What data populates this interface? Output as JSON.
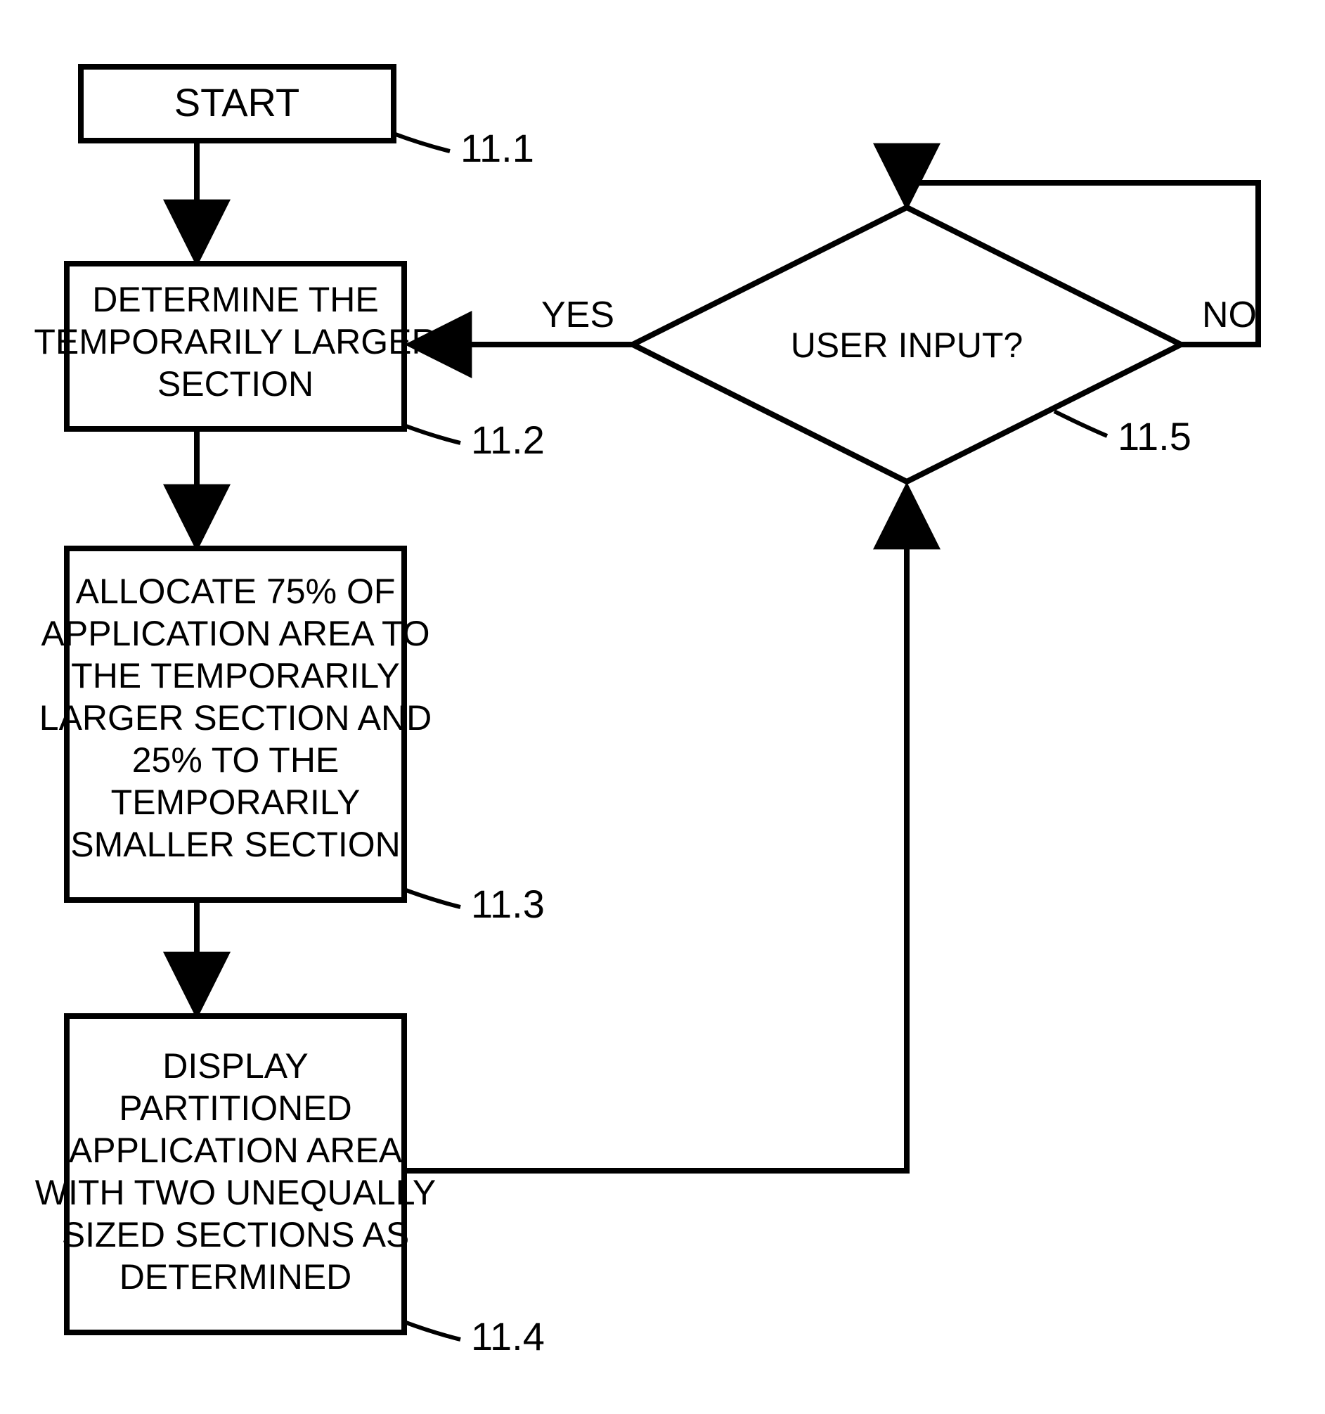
{
  "flowchart": {
    "nodes": {
      "start": {
        "text": "START",
        "ref": "11.1"
      },
      "determine": {
        "lines": [
          "DETERMINE THE",
          "TEMPORARILY LARGER",
          "SECTION"
        ],
        "ref": "11.2"
      },
      "allocate": {
        "lines": [
          "ALLOCATE 75% OF",
          "APPLICATION AREA TO",
          "THE TEMPORARILY",
          "LARGER SECTION AND",
          "25% TO THE",
          "TEMPORARILY",
          "SMALLER SECTION"
        ],
        "ref": "11.3"
      },
      "display": {
        "lines": [
          "DISPLAY",
          "PARTITIONED",
          "APPLICATION AREA",
          "WITH TWO UNEQUALLY",
          "SIZED SECTIONS AS",
          "DETERMINED"
        ],
        "ref": "11.4"
      },
      "decision": {
        "text": "USER INPUT?",
        "ref": "11.5"
      }
    },
    "edges": {
      "yes": "YES",
      "no": "NO"
    }
  }
}
